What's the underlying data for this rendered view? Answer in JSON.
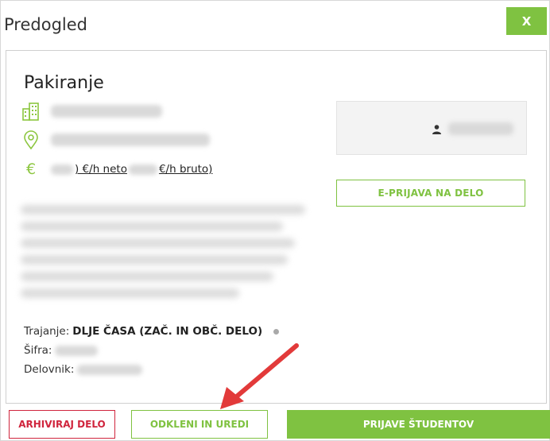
{
  "dialog": {
    "title": "Predogled",
    "close_label": "X"
  },
  "job": {
    "title": "Pakiranje",
    "pay": {
      "neto_suffix": ") €/h neto",
      "bruto_suffix": " €/h bruto)"
    },
    "meta": {
      "trajanje_label": "Trajanje:",
      "trajanje_value": "DLJE ČASA (ZAČ. IN OBČ. DELO)",
      "sifra_label": "Šifra:",
      "delovnik_label": "Delovnik:"
    }
  },
  "side": {
    "eprijava_label": "E-PRIJAVA NA DELO"
  },
  "footer": {
    "arhiviraj_label": "ARHIVIRAJ DELO",
    "odkleni_label": "ODKLENI IN UREDI",
    "prijave_label": "PRIJAVE ŠTUDENTOV"
  },
  "icons": {
    "building": "building-icon",
    "location": "location-pin-icon",
    "euro": "euro-icon",
    "person": "person-icon"
  },
  "colors": {
    "accent_green": "#7fc241",
    "danger_red": "#d0253d",
    "arrow_red": "#e23a3a"
  }
}
